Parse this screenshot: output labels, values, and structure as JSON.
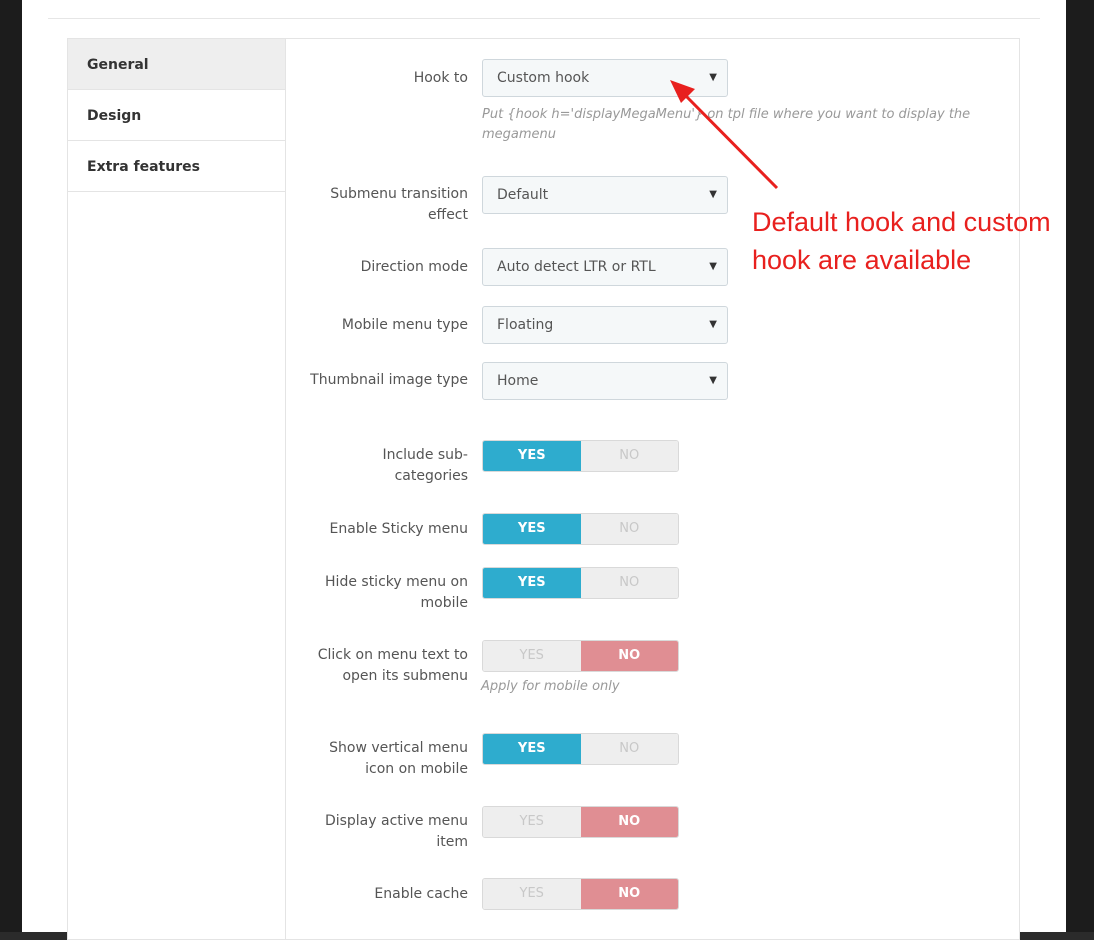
{
  "tabs": [
    {
      "label": "General",
      "active": true
    },
    {
      "label": "Design",
      "active": false
    },
    {
      "label": "Extra features",
      "active": false
    }
  ],
  "fields": {
    "hook_to": {
      "label": "Hook to",
      "value": "Custom hook",
      "help": "Put {hook h='displayMegaMenu'} on tpl file where you want to display the megamenu"
    },
    "submenu_transition": {
      "label": "Submenu transition effect",
      "value": "Default"
    },
    "direction_mode": {
      "label": "Direction mode",
      "value": "Auto detect LTR or RTL"
    },
    "mobile_menu_type": {
      "label": "Mobile menu type",
      "value": "Floating"
    },
    "thumbnail_image_type": {
      "label": "Thumbnail image type",
      "value": "Home"
    },
    "include_subcategories": {
      "label": "Include sub-categories",
      "value": "YES"
    },
    "enable_sticky_menu": {
      "label": "Enable Sticky menu",
      "value": "YES"
    },
    "hide_sticky_mobile": {
      "label": "Hide sticky menu on mobile",
      "value": "YES"
    },
    "click_menu_text": {
      "label": "Click on menu text to open its submenu",
      "value": "NO",
      "help": "Apply for mobile only"
    },
    "show_vertical_icon": {
      "label": "Show vertical menu icon on mobile",
      "value": "YES"
    },
    "display_active_item": {
      "label": "Display active menu item",
      "value": "NO"
    },
    "enable_cache": {
      "label": "Enable cache",
      "value": "NO"
    }
  },
  "switch_labels": {
    "yes": "YES",
    "no": "NO"
  },
  "annotation": {
    "line1": "Default hook and custom",
    "line2": "hook are available",
    "color": "#e8201e"
  },
  "colors": {
    "yes_active": "#2eacce",
    "no_active": "#e08e93",
    "tab_active_bg": "#eeeeee"
  },
  "icons": {
    "select_arrow": "caret-down-icon"
  }
}
